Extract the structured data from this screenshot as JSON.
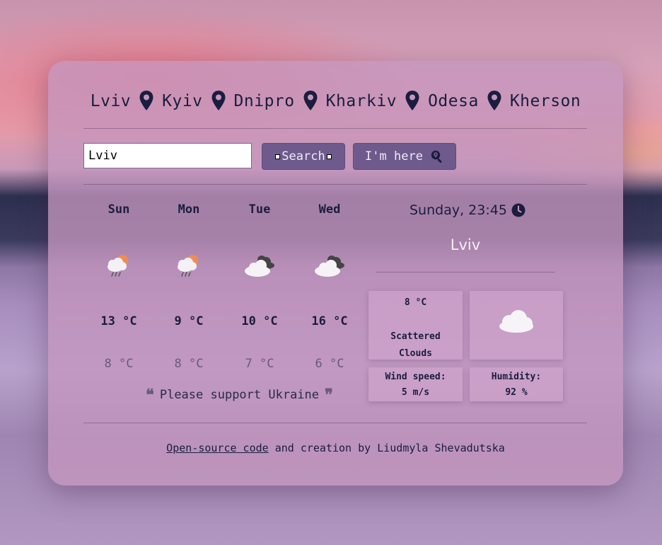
{
  "cities": [
    "Lviv",
    "Kyiv",
    "Dnipro",
    "Kharkiv",
    "Odesa",
    "Kherson"
  ],
  "search": {
    "value": "Lviv",
    "search_label": "Search",
    "here_label": "I'm here"
  },
  "forecast": [
    {
      "day": "Sun",
      "icon": "rain-sun-icon",
      "high": "13 °C",
      "low": "8 °C"
    },
    {
      "day": "Mon",
      "icon": "rain-sun-icon",
      "high": "9 °C",
      "low": "8 °C"
    },
    {
      "day": "Tue",
      "icon": "dark-clouds-icon",
      "high": "10 °C",
      "low": "7 °C"
    },
    {
      "day": "Wed",
      "icon": "dark-clouds-icon",
      "high": "16 °C",
      "low": "6 °C"
    }
  ],
  "quote": "Please support Ukraine",
  "current": {
    "datetime": "Sunday, 23:45",
    "city": "Lviv",
    "temp": "8 °C",
    "description": "Scattered Clouds",
    "icon": "cloud-icon",
    "wind_label": "Wind speed:",
    "wind_value": "5 m/s",
    "humidity_label": "Humidity:",
    "humidity_value": "92 %"
  },
  "footer": {
    "link_text": "Open-source code",
    "rest_text": " and creation by Liudmyla Shevadutska"
  },
  "colors": {
    "accent_button": "#6e5a8c",
    "text_dark": "#1b1d3e",
    "card": "#c496be"
  }
}
